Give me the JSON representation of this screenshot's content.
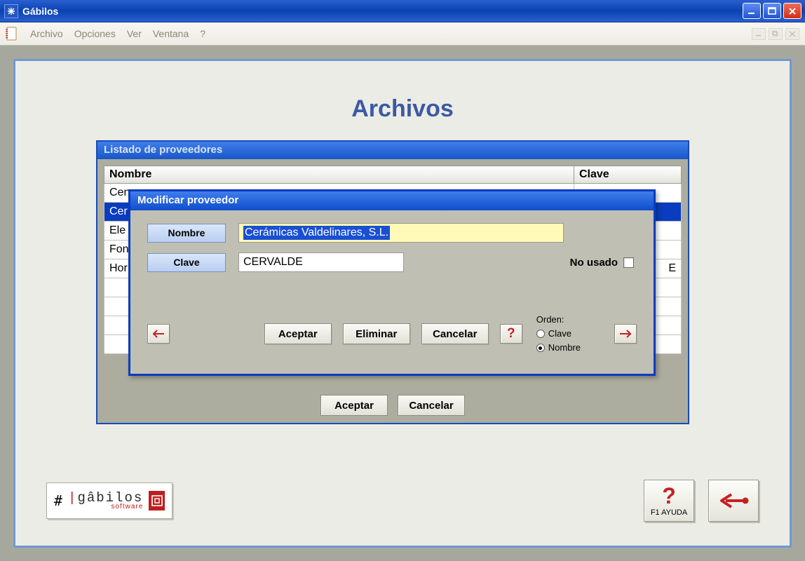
{
  "window": {
    "title": "Gábilos"
  },
  "menu": {
    "items": [
      "Archivo",
      "Opciones",
      "Ver",
      "Ventana",
      "?"
    ]
  },
  "page": {
    "title": "Archivos"
  },
  "list_window": {
    "title": "Listado de proveedores",
    "columns": {
      "nombre": "Nombre",
      "clave": "Clave"
    },
    "rows": [
      {
        "nombre": "Cen",
        "clave": ""
      },
      {
        "nombre": "Cer",
        "clave": ""
      },
      {
        "nombre": "Ele",
        "clave": ""
      },
      {
        "nombre": "Fon",
        "clave": ""
      },
      {
        "nombre": "Hor",
        "clave": "E"
      }
    ],
    "buttons": {
      "aceptar": "Aceptar",
      "cancelar": "Cancelar"
    }
  },
  "modal": {
    "title": "Modificar proveedor",
    "labels": {
      "nombre": "Nombre",
      "clave": "Clave",
      "no_usado": "No usado"
    },
    "values": {
      "nombre": "Cerámicas Valdelinares, S.L.",
      "clave": "CERVALDE"
    },
    "buttons": {
      "aceptar": "Aceptar",
      "eliminar": "Eliminar",
      "cancelar": "Cancelar",
      "help": "?"
    },
    "orden": {
      "title": "Orden:",
      "clave": "Clave",
      "nombre": "Nombre",
      "selected": "nombre"
    }
  },
  "bottom": {
    "logo_main": "gâbilos",
    "logo_sub": "software",
    "help_label": "F1 AYUDA"
  }
}
